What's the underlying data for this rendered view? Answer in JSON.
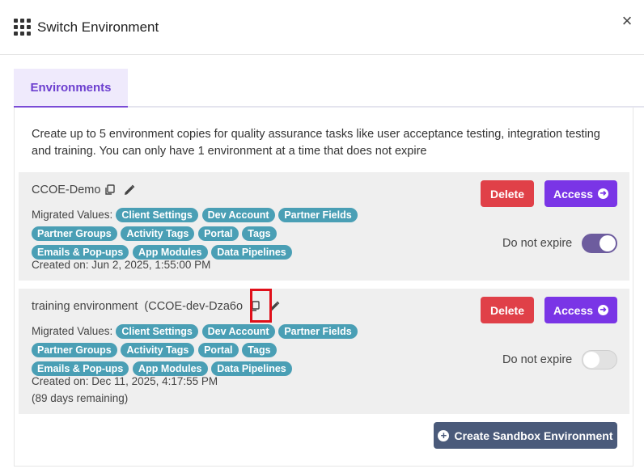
{
  "modal": {
    "title": "Switch Environment",
    "close_symbol": "×",
    "icon": "grid-icon"
  },
  "tabs": [
    {
      "label": "Environments",
      "active": true
    }
  ],
  "description": "Create up to 5 environment copies for quality assurance tasks like user acceptance testing, integration testing and training. You can only have 1 environment at a time that does not expire",
  "environments": [
    {
      "name": "CCOE-Demo",
      "code": "",
      "migrated_label": "Migrated Values:",
      "tags": [
        "Client Settings",
        "Dev Account",
        "Partner Fields",
        "Partner Groups",
        "Activity Tags",
        "Portal",
        "Tags",
        "Emails & Pop-ups",
        "App Modules",
        "Data Pipelines"
      ],
      "created": "Created on: Jun 2, 2025, 1:55:00 PM",
      "remaining": "",
      "delete_label": "Delete",
      "access_label": "Access",
      "expire_label": "Do not expire",
      "do_not_expire": true
    },
    {
      "name": "training environment",
      "code": "(CCOE-dev-Dza6o",
      "migrated_label": "Migrated Values:",
      "tags": [
        "Client Settings",
        "Dev Account",
        "Partner Fields",
        "Partner Groups",
        "Activity Tags",
        "Portal",
        "Tags",
        "Emails & Pop-ups",
        "App Modules",
        "Data Pipelines"
      ],
      "created": "Created on: Dec 11, 2025, 4:17:55 PM",
      "remaining": "(89 days remaining)",
      "delete_label": "Delete",
      "access_label": "Access",
      "expire_label": "Do not expire",
      "do_not_expire": false
    }
  ],
  "create_button_label": "Create Sandbox Environment",
  "colors": {
    "accent": "#7a35e6",
    "delete": "#e04048",
    "tag": "#4a9fb5",
    "create_button": "#4a5a7a",
    "highlight": "#e0101a"
  }
}
